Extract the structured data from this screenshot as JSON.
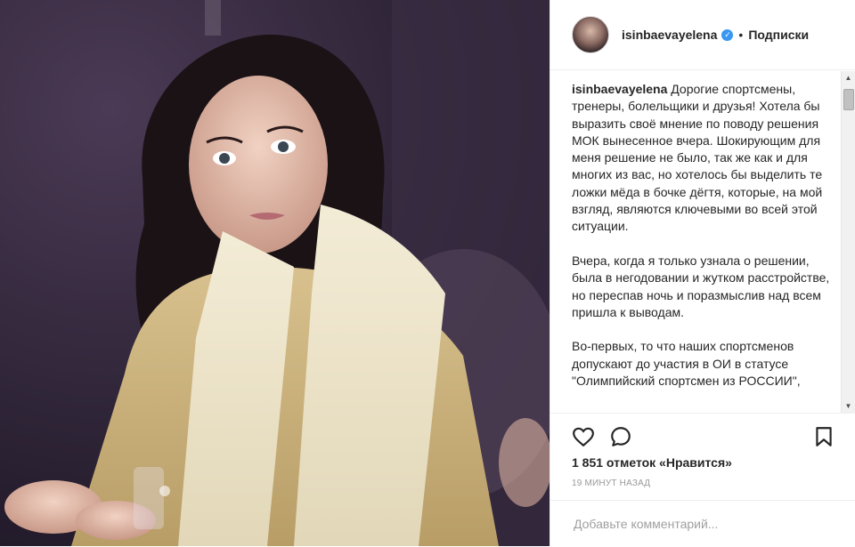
{
  "post": {
    "image_alt": "photo",
    "header": {
      "username": "isinbaevayelena",
      "verified_glyph": "✓",
      "separator": "•",
      "follow_label": "Подписки"
    },
    "caption": {
      "username": "isinbaevayelena",
      "text": "Дорогие спортсмены, тренеры, болельщики и друзья! Хотела бы выразить своё мнение по поводу решения МОК вынесенное вчера. Шокирующим для меня решение не было, так же как и для многих из вас, но хотелось бы выделить те ложки мёда в бочке дёгтя, которые, на мой взгляд, являются ключевыми во всей этой ситуации.\n\nВчера, когда я только узнала о решении, была в негодовании и жутком расстройстве, но переспав ночь и поразмыслив над всем пришла к выводам.\n\nВо-первых, то что наших спортсменов допускают до участия в ОИ в статусе \"Олимпийский спортсмен из РОССИИ\","
    },
    "actions": {
      "like_icon": "heart-icon",
      "comment_icon": "comment-bubble-icon",
      "save_icon": "bookmark-icon"
    },
    "likes": "1 851 отметок «Нравится»",
    "time_ago": "19 МИНУТ НАЗАД",
    "comment": {
      "placeholder": "Добавьте комментарий..."
    },
    "colors": {
      "verified": "#3897f0",
      "text": "#262626",
      "muted": "#999999",
      "border": "#efefef"
    }
  }
}
